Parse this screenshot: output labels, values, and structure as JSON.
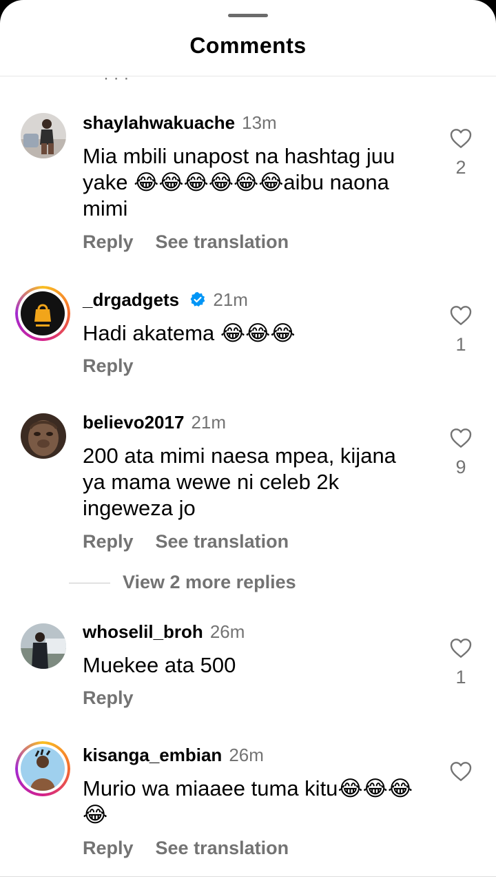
{
  "sheet": {
    "title": "Comments"
  },
  "comments": [
    {
      "username": "shaylahwakuache",
      "time": "13m",
      "text": "Mia mbili unapost na hashtag juu yake 😂😂😂😂😂😂aibu naona mimi",
      "reply": "Reply",
      "translate": "See translation",
      "likes": "2",
      "verified": false
    },
    {
      "username": "_drgadgets",
      "time": "21m",
      "text": "Hadi akatema 😂😂😂",
      "reply": "Reply",
      "translate": "",
      "likes": "1",
      "verified": true
    },
    {
      "username": "believo2017",
      "time": "21m",
      "text": "200 ata mimi naesa mpea, kijana ya mama wewe ni celeb 2k ingeweza jo",
      "reply": "Reply",
      "translate": "See translation",
      "likes": "9",
      "verified": false
    },
    {
      "username": "whoselil_broh",
      "time": "26m",
      "text": "Muekee ata 500",
      "reply": "Reply",
      "translate": "",
      "likes": "1",
      "verified": false
    },
    {
      "username": "kisanga_embian",
      "time": "26m",
      "text": "Murio wa miaaee tuma kitu😂😂😂😂",
      "reply": "Reply",
      "translate": "See translation",
      "likes": "",
      "verified": false
    }
  ],
  "view_more": "View 2 more replies",
  "colors": {
    "verified": "#0095f6",
    "muted": "#737373"
  },
  "icons": {
    "like": "heart-icon",
    "verified": "verified-badge-icon"
  }
}
